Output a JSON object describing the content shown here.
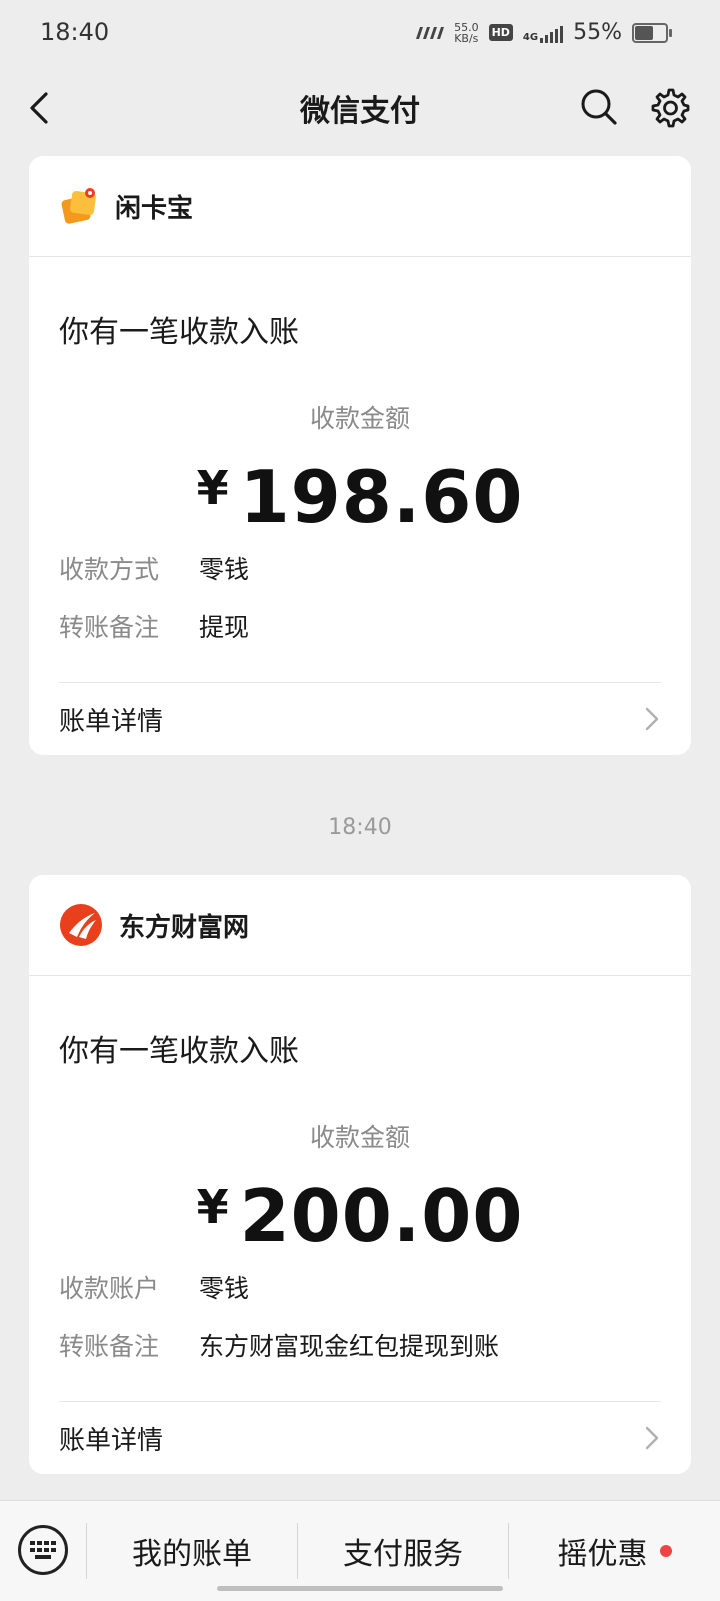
{
  "status": {
    "time": "18:40",
    "net_speed_value": "55.0",
    "net_speed_unit": "KB/s",
    "hd": "HD",
    "network": "4G",
    "battery": "55%",
    "battery_level": 0.55
  },
  "nav": {
    "title": "微信支付"
  },
  "cards": [
    {
      "merchant": "闲卡宝",
      "title": "你有一笔收款入账",
      "amount_label": "收款金额",
      "currency": "¥",
      "amount": "198.60",
      "rows": [
        {
          "k": "收款方式",
          "v": "零钱"
        },
        {
          "k": "转账备注",
          "v": "提现"
        }
      ],
      "detail": "账单详情"
    },
    {
      "merchant": "东方财富网",
      "title": "你有一笔收款入账",
      "amount_label": "收款金额",
      "currency": "¥",
      "amount": "200.00",
      "rows": [
        {
          "k": "收款账户",
          "v": "零钱"
        },
        {
          "k": "转账备注",
          "v": "东方财富现金红包提现到账"
        }
      ],
      "detail": "账单详情"
    }
  ],
  "timestamp": "18:40",
  "bottom": {
    "tabs": [
      "我的账单",
      "支付服务",
      "摇优惠"
    ]
  },
  "colors": {
    "accent_red": "#f04444",
    "xkb_orange": "#f39a1e",
    "dfcf_red": "#e8401c"
  }
}
